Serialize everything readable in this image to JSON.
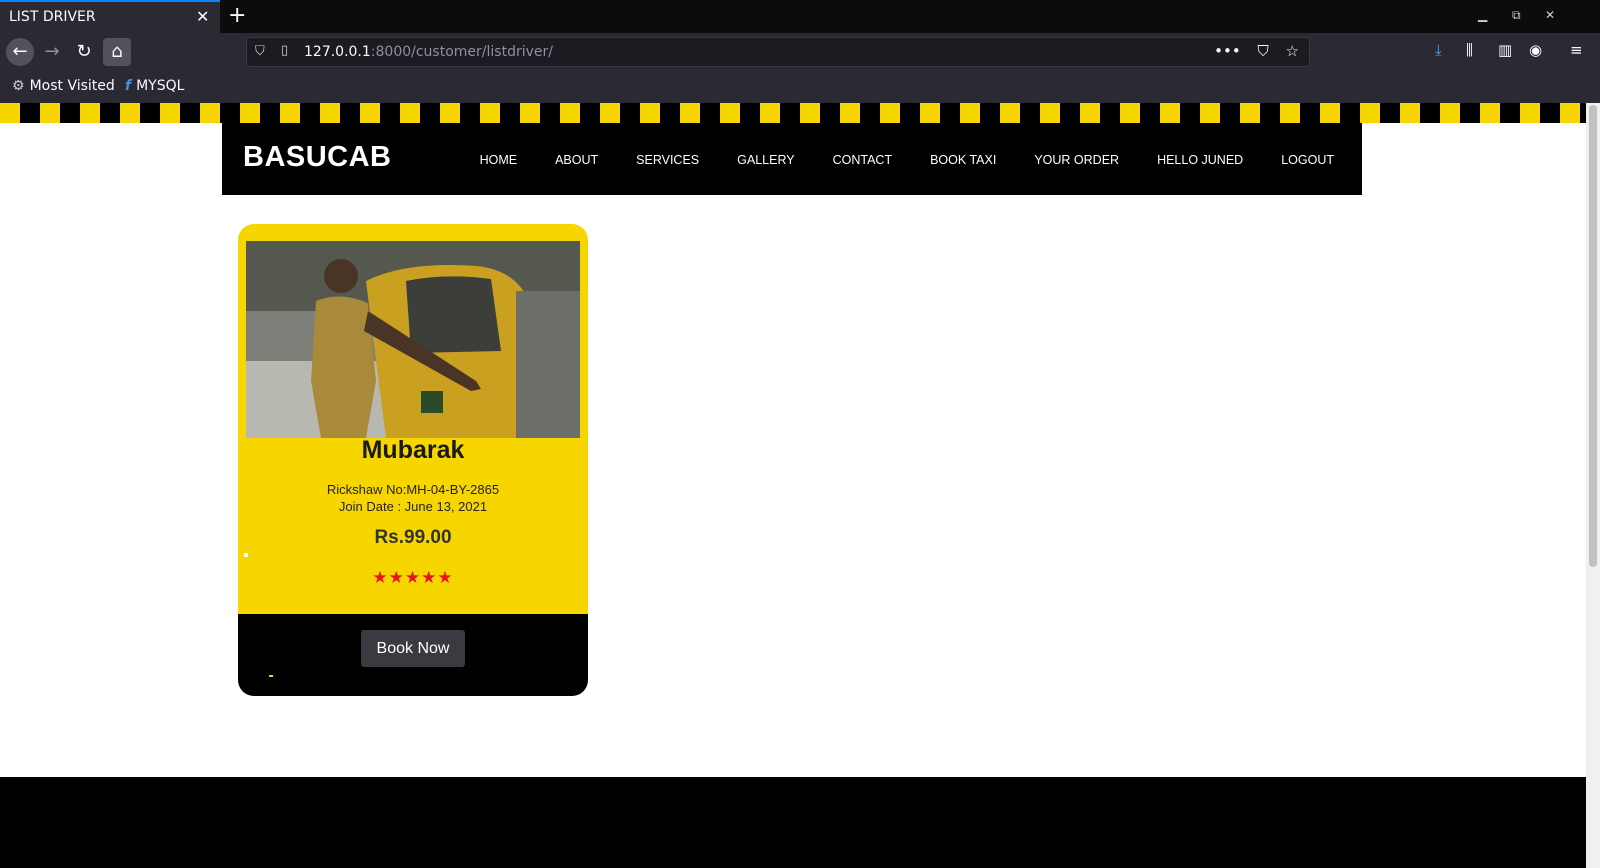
{
  "browser": {
    "tab_title": "LIST DRIVER",
    "url_host": "127.0.0.1",
    "url_path": ":8000/customer/listdriver/",
    "bookmarks": [
      {
        "label": "Most Visited",
        "icon": "gear-icon"
      },
      {
        "label": "MYSQL",
        "icon": "fedora-icon"
      }
    ]
  },
  "site": {
    "logo": "BASUCAB",
    "menu": [
      "HOME",
      "ABOUT",
      "SERVICES",
      "GALLERY",
      "CONTACT",
      "BOOK TAXI",
      "YOUR ORDER",
      "HELLO JUNED",
      "LOGOUT"
    ]
  },
  "driver_card": {
    "name": "Mubarak",
    "rickshaw": "Rickshaw No:MH-04-BY-2865",
    "join_date": "Join Date : June 13, 2021",
    "price": "Rs.99.00",
    "rating": 5,
    "stars": "★★★★★",
    "book_label": "Book Now"
  },
  "colors": {
    "accent_yellow": "#f7d600",
    "star_red": "#e8141e",
    "header_black": "#000000"
  }
}
